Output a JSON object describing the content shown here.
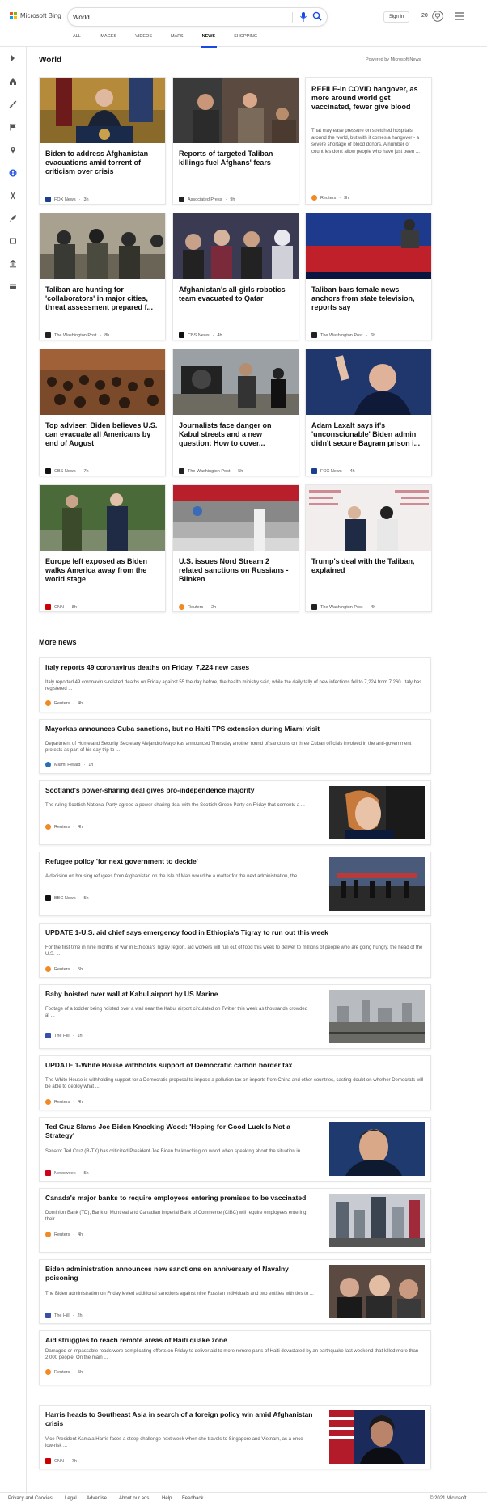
{
  "header": {
    "brand": "Microsoft Bing",
    "search_value": "World",
    "signin_label": "Sign in",
    "rewards_count": "20",
    "tabs": [
      "ALL",
      "IMAGES",
      "VIDEOS",
      "MAPS",
      "NEWS",
      "SHOPPING"
    ],
    "active_tab": "NEWS"
  },
  "sidebar": {
    "icons": [
      "chevron-right-icon",
      "home-icon",
      "sparkle-icon",
      "flag-icon",
      "location-icon",
      "globe-icon",
      "science-icon",
      "rocket-icon",
      "film-icon",
      "bank-icon",
      "card-icon"
    ]
  },
  "section": {
    "title": "World",
    "powered_by": "Powered by Microsoft News"
  },
  "cards": [
    {
      "title": "Biden to address Afghanistan evacuations amid torrent of criticism over crisis",
      "source": "FOX News",
      "time": "3h",
      "src_color": "#1b3f8b"
    },
    {
      "title": "Reports of targeted Taliban killings fuel Afghans' fears",
      "source": "Associated Press",
      "time": "9h",
      "src_color": "#222222"
    },
    {
      "title": "REFILE-In COVID hangover, as more around world get vaccinated, fewer give blood",
      "snippet": "That may ease pressure on stretched hospitals around the world, but with it comes a hangover - a severe shortage of blood donors. A number of countries don't allow people who have just been ...",
      "source": "Reuters",
      "time": "3h",
      "src_color": "#f08a24"
    },
    {
      "title": "Taliban are hunting for 'collaborators' in major cities, threat assessment prepared f...",
      "source": "The Washington Post",
      "time": "8h",
      "src_color": "#222222"
    },
    {
      "title": "Afghanistan's all-girls robotics team evacuated to Qatar",
      "source": "CBS News",
      "time": "4h",
      "src_color": "#111111"
    },
    {
      "title": "Taliban bars female news anchors from state television, reports say",
      "source": "The Washington Post",
      "time": "6h",
      "src_color": "#222222"
    },
    {
      "title": "Top adviser: Biden believes U.S. can evacuate all Americans by end of August",
      "source": "CBS News",
      "time": "7h",
      "src_color": "#111111"
    },
    {
      "title": "Journalists face danger on Kabul streets and a new question: How to cover...",
      "source": "The Washington Post",
      "time": "5h",
      "src_color": "#222222"
    },
    {
      "title": "Adam Laxalt says it's 'unconscionable' Biden admin didn't secure Bagram prison i...",
      "source": "FOX News",
      "time": "4h",
      "src_color": "#1b3f8b"
    },
    {
      "title": "Europe left exposed as Biden walks America away from the world stage",
      "source": "CNN",
      "time": "8h",
      "src_color": "#cc0000"
    },
    {
      "title": "U.S. issues Nord Stream 2 related sanctions on Russians - Blinken",
      "source": "Reuters",
      "time": "2h",
      "src_color": "#f08a24"
    },
    {
      "title": "Trump's deal with the Taliban, explained",
      "source": "The Washington Post",
      "time": "4h",
      "src_color": "#222222"
    }
  ],
  "more_news": {
    "title": "More news",
    "items": [
      {
        "title": "Italy reports 49 coronavirus deaths on Friday, 7,224 new cases",
        "snippet": "Italy reported 49 coronavirus-related deaths on Friday against 55 the day before, the health ministry said, while the daily tally of new infections fell to 7,224 from 7,260. Italy has registered ...",
        "source": "Reuters",
        "time": "4h",
        "src_color": "#f08a24"
      },
      {
        "title": "Mayorkas announces Cuba sanctions, but no Haiti TPS extension during Miami visit",
        "snippet": "Department of Homeland Security Secretary Alejandro Mayorkas announced Thursday another round of sanctions on three Cuban officials involved in the anti-government protests as part of his day trip to ...",
        "source": "Miami Herald",
        "time": "1h",
        "src_color": "#2a6fb0"
      },
      {
        "title": "Scotland's power-sharing deal gives pro-independence majority",
        "snippet": "The ruling Scottish National Party agreed a power-sharing deal with the Scottish Green Party on Friday that cements a ...",
        "source": "Reuters",
        "time": "4h",
        "src_color": "#f08a24"
      },
      {
        "title": "Refugee policy 'for next government to decide'",
        "snippet": "A decision on housing refugees from Afghanistan on the Isle of Man would be a matter for the next administration, the ...",
        "source": "BBC News",
        "time": "5h",
        "src_color": "#111111"
      },
      {
        "title": "UPDATE 1-U.S. aid chief says emergency food in Ethiopia's Tigray to run out this week",
        "snippet": "For the first time in nine months of war in Ethiopia's Tigray region, aid workers will run out of food this week to deliver to millions of people who are going hungry, the head of the U.S. ...",
        "source": "Reuters",
        "time": "5h",
        "src_color": "#f08a24"
      },
      {
        "title": "Baby hoisted over wall at Kabul airport by US Marine",
        "snippet": "Footage of a toddler being hoisted over a wall near the Kabul airport circulated on Twitter this week as thousands crowded at ...",
        "source": "The Hill",
        "time": "1h",
        "src_color": "#3a4fa8"
      },
      {
        "title": "UPDATE 1-White House withholds support of Democratic carbon border tax",
        "snippet": "The White House is withholding support for a Democratic proposal to impose a pollution tax on imports from China and other countries, casting doubt on whether Democrats will be able to deploy what ...",
        "source": "Reuters",
        "time": "4h",
        "src_color": "#f08a24"
      },
      {
        "title": "Ted Cruz Slams Joe Biden Knocking Wood: 'Hoping for Good Luck Is Not a Strategy'",
        "snippet": "Senator Ted Cruz (R-TX) has criticized President Joe Biden for knocking on wood when speaking about the situation in ...",
        "source": "Newsweek",
        "time": "5h",
        "src_color": "#d0021b"
      },
      {
        "title": "Canada's major banks to require employees entering premises to be vaccinated",
        "snippet": "Dominion Bank (TD), Bank of Montreal and Canadian Imperial Bank of Commerce (CIBC) will require employees entering their ...",
        "source": "Reuters",
        "time": "4h",
        "src_color": "#f08a24"
      },
      {
        "title": "Biden administration announces new sanctions on anniversary of Navalny poisoning",
        "snippet": "The Biden administration on Friday levied additional sanctions against nine Russian individuals and two entities with ties to ...",
        "source": "The Hill",
        "time": "2h",
        "src_color": "#3a4fa8"
      },
      {
        "title": "Aid struggles to reach remote areas of Haiti quake zone",
        "snippet": "Damaged or impassable roads were complicating efforts on Friday to deliver aid to more remote parts of Haiti devastated by an earthquake last weekend that killed more than 2,000 people. On the main ...",
        "source": "Reuters",
        "time": "5h",
        "src_color": "#f08a24"
      },
      {
        "title": "Harris heads to Southeast Asia in search of a foreign policy win amid Afghanistan crisis",
        "snippet": "Vice President Kamala Harris faces a steep challenge next week when she travels to Singapore and Vietnam, as a once-low-risk ...",
        "source": "CNN",
        "time": "7h",
        "src_color": "#cc0000"
      }
    ]
  },
  "footer": {
    "links": [
      "Privacy and Cookies",
      "Legal",
      "Advertise",
      "About our ads",
      "Help",
      "Feedback"
    ],
    "copyright": "© 2021 Microsoft"
  },
  "colors": {
    "accent": "#174ae4",
    "brand_red": "#f25022",
    "brand_green": "#7fba00",
    "brand_blue": "#00a4ef",
    "brand_yellow": "#ffb900"
  }
}
